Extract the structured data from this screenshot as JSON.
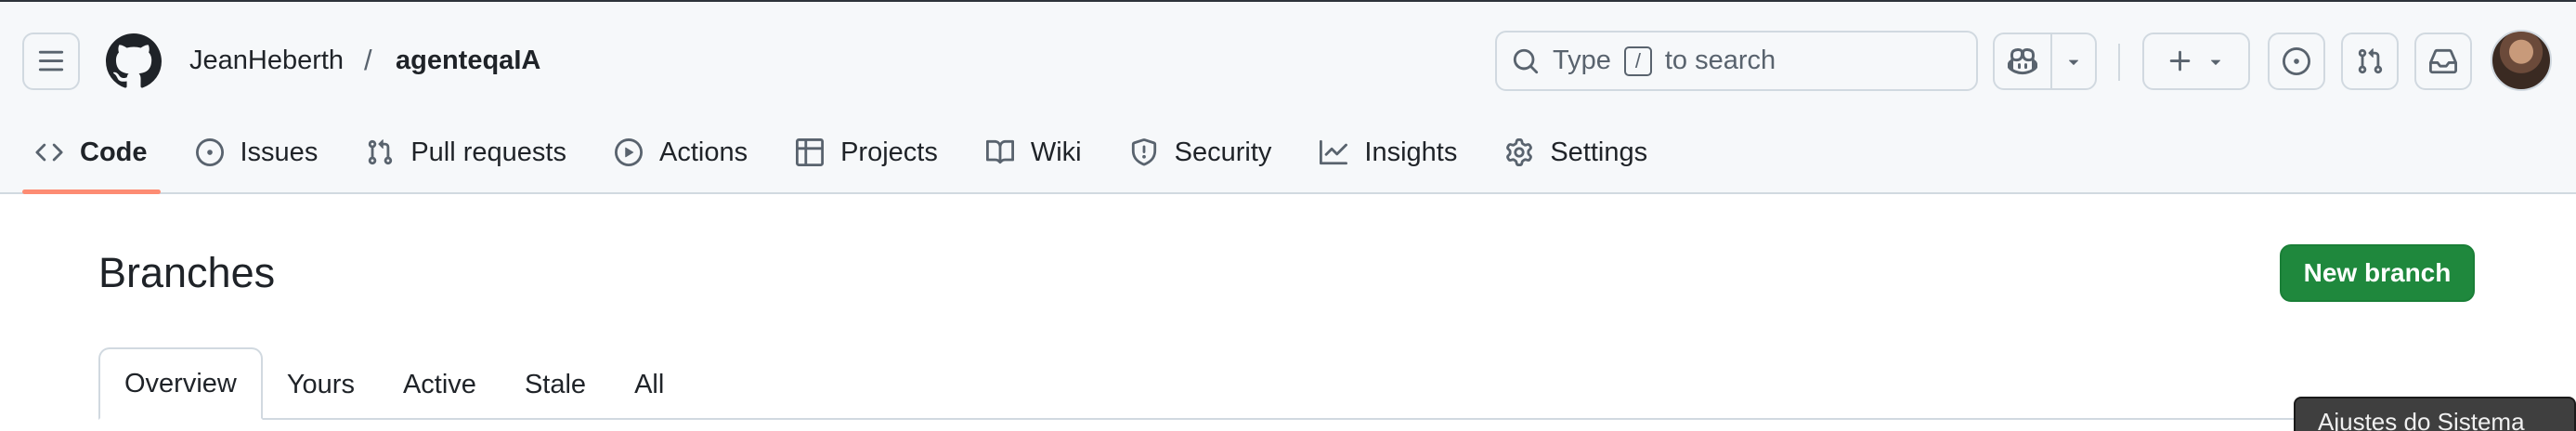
{
  "header": {
    "owner": "JeanHeberth",
    "separator": "/",
    "repo": "agenteqaIA",
    "search": {
      "prefix": "Type",
      "key": "/",
      "suffix": "to search"
    }
  },
  "icons": {
    "menu": "hamburger-icon",
    "logo": "github-logo",
    "search": "search-icon",
    "copilot": "copilot-icon",
    "create": "plus-icon",
    "issues": "issue-opened-icon",
    "pulls": "git-pull-request-icon",
    "inbox": "inbox-icon"
  },
  "nav": [
    {
      "label": "Code",
      "icon": "code-icon",
      "active": true
    },
    {
      "label": "Issues",
      "icon": "issue-opened-icon"
    },
    {
      "label": "Pull requests",
      "icon": "git-pull-request-icon"
    },
    {
      "label": "Actions",
      "icon": "play-icon"
    },
    {
      "label": "Projects",
      "icon": "table-icon"
    },
    {
      "label": "Wiki",
      "icon": "book-icon"
    },
    {
      "label": "Security",
      "icon": "shield-icon"
    },
    {
      "label": "Insights",
      "icon": "graph-icon"
    },
    {
      "label": "Settings",
      "icon": "gear-icon"
    }
  ],
  "page": {
    "title": "Branches",
    "new_branch_label": "New branch",
    "tabs": [
      {
        "label": "Overview",
        "active": true
      },
      {
        "label": "Yours"
      },
      {
        "label": "Active"
      },
      {
        "label": "Stale"
      },
      {
        "label": "All"
      }
    ]
  },
  "tooltip": "Ajustes do Sistema",
  "colors": {
    "accent_underline": "#fd8c73",
    "primary_button": "#1f883d",
    "header_bg": "#f6f8fa",
    "border": "#d1d9e0"
  }
}
